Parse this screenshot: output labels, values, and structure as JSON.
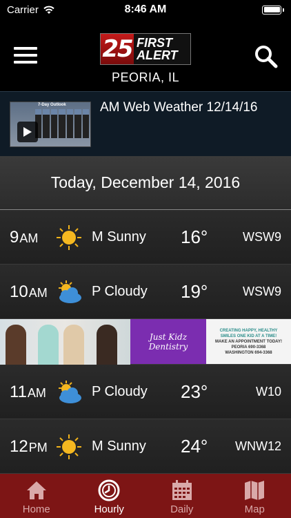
{
  "status": {
    "carrier": "Carrier",
    "time": "8:46 AM",
    "battery_level": 1.0
  },
  "header": {
    "logo_number": "25",
    "logo_line1": "FIRST",
    "logo_line2": "ALERT",
    "location": "PEORIA, IL"
  },
  "video": {
    "title": "AM Web Weather 12/14/16",
    "thumb_caption": "7-Day Outlook"
  },
  "date_banner": "Today, December 14, 2016",
  "hourly": [
    {
      "hour": "9",
      "ampm": "AM",
      "icon": "sun-icon",
      "condition": "M Sunny",
      "temp": "16°",
      "wind": "WSW9"
    },
    {
      "hour": "10",
      "ampm": "AM",
      "icon": "partly-cloudy-icon",
      "condition": "P Cloudy",
      "temp": "19°",
      "wind": "WSW9"
    },
    {
      "hour": "11",
      "ampm": "AM",
      "icon": "partly-cloudy-icon",
      "condition": "P Cloudy",
      "temp": "23°",
      "wind": "W10"
    },
    {
      "hour": "12",
      "ampm": "PM",
      "icon": "sun-icon",
      "condition": "M Sunny",
      "temp": "24°",
      "wind": "WNW12"
    }
  ],
  "ad": {
    "brand": "Just Kidz Dentistry",
    "line1": "CREATING HAPPY, HEALTHY",
    "line2": "SMILES ONE KID AT A TIME!",
    "line3": "MAKE AN APPOINTMENT TODAY!",
    "line4": "PEORIA 690-3368",
    "line5": "WASHINGTON 694-3368"
  },
  "tabs": [
    {
      "label": "Home",
      "icon": "home-icon",
      "active": false
    },
    {
      "label": "Hourly",
      "icon": "clock-icon",
      "active": true
    },
    {
      "label": "Daily",
      "icon": "calendar-icon",
      "active": false
    },
    {
      "label": "Map",
      "icon": "map-icon",
      "active": false
    }
  ],
  "colors": {
    "tab_bar": "#7d1515",
    "brand_red": "#c41a1a",
    "ad_purple": "#7b2db0"
  }
}
